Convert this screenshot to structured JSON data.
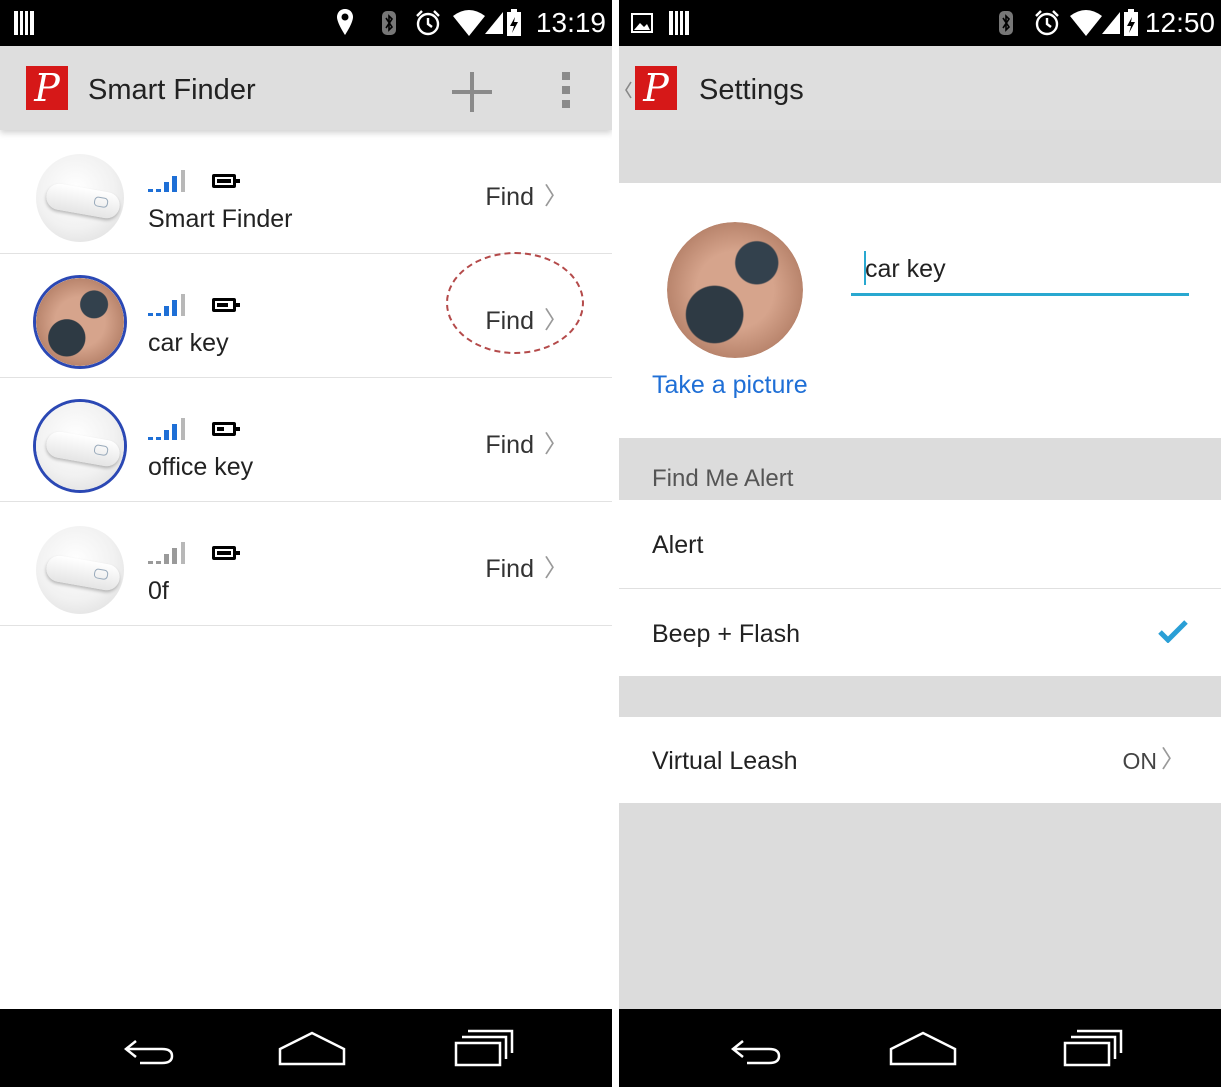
{
  "left_screen": {
    "status_time": "13:19",
    "app_title": "Smart Finder",
    "logo_letter": "P",
    "actions": {
      "add_icon": "plus-icon",
      "overflow_icon": "more-vert-icon"
    },
    "devices": [
      {
        "name": "Smart Finder",
        "action": "Find",
        "photo": "device",
        "ring": false,
        "signal_color": "#1e6fd6",
        "battery_level": 1.0
      },
      {
        "name": "car key",
        "action": "Find",
        "photo": "key",
        "ring": true,
        "signal_color": "#1e6fd6",
        "battery_level": 0.8
      },
      {
        "name": "office key",
        "action": "Find",
        "photo": "device",
        "ring": true,
        "signal_color": "#1e6fd6",
        "battery_level": 0.5
      },
      {
        "name": "0f",
        "action": "Find",
        "photo": "device",
        "ring": false,
        "signal_color": "#9a9a9a",
        "battery_level": 1.0
      }
    ]
  },
  "right_screen": {
    "status_time": "12:50",
    "title": "Settings",
    "logo_letter": "P",
    "name_value": "car key",
    "take_picture": "Take a picture",
    "find_me_header": "Find Me Alert",
    "alert_label": "Alert",
    "beep_flash_label": "Beep + Flash",
    "beep_flash_checked": true,
    "virtual_leash_label": "Virtual Leash",
    "virtual_leash_value": "ON"
  },
  "colors": {
    "accent": "#29a8d0",
    "link": "#1f6fd6",
    "logo": "#d61818",
    "ring": "#2b48b4",
    "highlight": "#b44a4a"
  }
}
